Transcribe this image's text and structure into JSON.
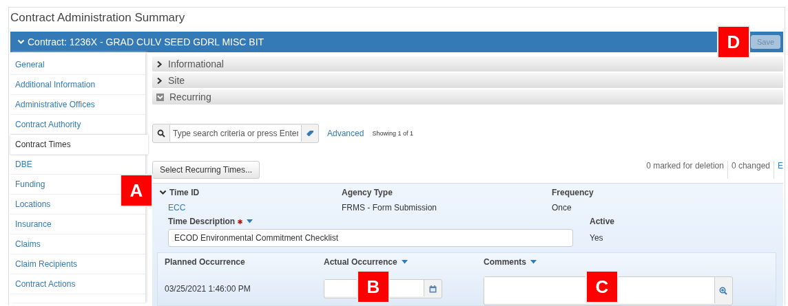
{
  "page_title": "Contract Administration Summary",
  "contract_bar": {
    "label": "Contract: 1236X - GRAD CULV SEED GDRL MISC BIT",
    "expanded": true
  },
  "save_button": {
    "label": "Save",
    "disabled": true
  },
  "sidebar": {
    "items": [
      {
        "label": "General",
        "selected": false
      },
      {
        "label": "Additional Information",
        "selected": false
      },
      {
        "label": "Administrative Offices",
        "selected": false
      },
      {
        "label": "Contract Authority",
        "selected": false
      },
      {
        "label": "Contract Times",
        "selected": true
      },
      {
        "label": "DBE",
        "selected": false
      },
      {
        "label": "Funding",
        "selected": false
      },
      {
        "label": "Locations",
        "selected": false
      },
      {
        "label": "Insurance",
        "selected": false
      },
      {
        "label": "Claims",
        "selected": false
      },
      {
        "label": "Claim Recipients",
        "selected": false
      },
      {
        "label": "Contract Actions",
        "selected": false
      }
    ]
  },
  "sections": [
    {
      "label": "Informational",
      "expanded": false
    },
    {
      "label": "Site",
      "expanded": false
    },
    {
      "label": "Recurring",
      "expanded": true
    }
  ],
  "search": {
    "placeholder": "Type search criteria or press Enter",
    "advanced_link": "Advanced",
    "showing": "Showing 1 of 1"
  },
  "select_button": "Select Recurring Times...",
  "status": [
    {
      "text": "0 marked for deletion",
      "kind": "text"
    },
    {
      "text": "0 changed",
      "kind": "text"
    },
    {
      "text": "E",
      "kind": "link"
    }
  ],
  "record": {
    "expanded": true,
    "time_id": {
      "label": "Time ID",
      "value": "ECC"
    },
    "agency_type": {
      "label": "Agency Type",
      "value": "FRMS - Form Submission"
    },
    "frequency": {
      "label": "Frequency",
      "value": "Once"
    },
    "time_description": {
      "label": "Time Description",
      "required": true,
      "value": "ECOD Environmental Commitment Checklist"
    },
    "active": {
      "label": "Active",
      "value": "Yes"
    },
    "planned_occurrence": {
      "label": "Planned Occurrence",
      "value": "03/25/2021 1:46:00 PM"
    },
    "actual_occurrence": {
      "label": "Actual Occurrence"
    },
    "comments": {
      "label": "Comments"
    }
  },
  "callouts": [
    {
      "label": "A"
    },
    {
      "label": "B"
    },
    {
      "label": "C"
    },
    {
      "label": "D"
    }
  ]
}
